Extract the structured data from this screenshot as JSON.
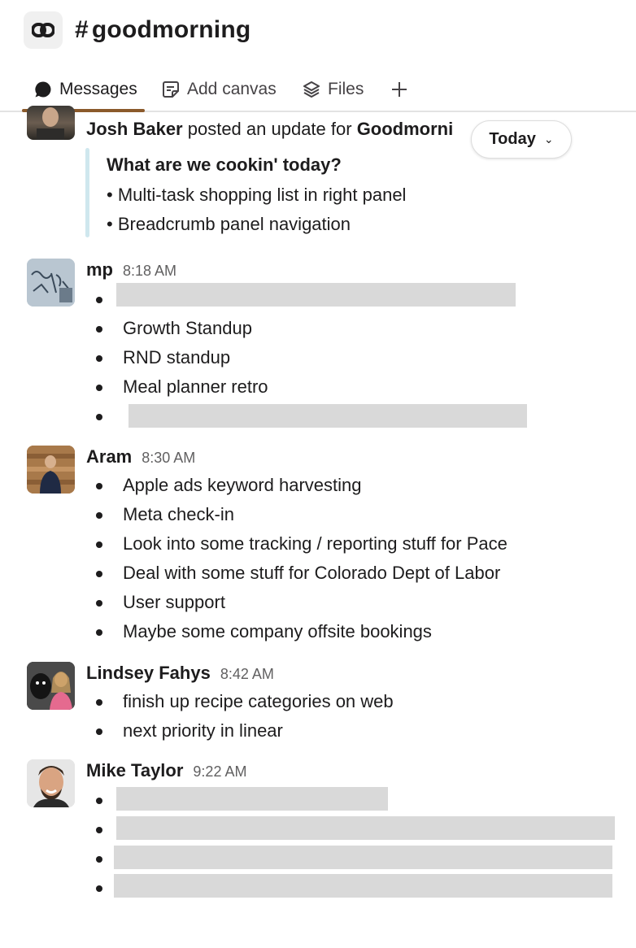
{
  "channel": {
    "hash": "#",
    "name": "goodmorning",
    "icon": "link-icon"
  },
  "tabs": [
    {
      "label": "Messages",
      "icon": "chat-bubble-icon",
      "active": true
    },
    {
      "label": "Add canvas",
      "icon": "canvas-icon",
      "active": false
    },
    {
      "label": "Files",
      "icon": "layers-icon",
      "active": false
    },
    {
      "label": "+",
      "icon": "plus-icon",
      "active": false
    }
  ],
  "date_divider": {
    "label": "Today",
    "icon": "chevron-down-icon"
  },
  "post": {
    "author": "Josh Baker",
    "text_middle": " posted an update for ",
    "target": "Goodmorni",
    "title": "What are we cookin' today?",
    "items": [
      "Multi-task shopping list in right panel",
      "Breadcrumb panel navigation"
    ]
  },
  "messages": [
    {
      "author": "mp",
      "time": "8:18 AM",
      "items": [
        "",
        "Growth Standup",
        "RND standup",
        "Meal planner retro",
        ""
      ]
    },
    {
      "author": "Aram",
      "time": "8:30 AM",
      "items": [
        "Apple ads keyword harvesting",
        "Meta check-in",
        "Look into some tracking / reporting stuff for Pace",
        "Deal with some stuff for Colorado Dept of Labor",
        "User support",
        "Maybe some company offsite bookings"
      ]
    },
    {
      "author": "Lindsey Fahys",
      "time": "8:42 AM",
      "items": [
        "finish up recipe categories on web",
        "next priority in linear"
      ]
    },
    {
      "author": "Mike Taylor",
      "time": "9:22 AM",
      "items": [
        "",
        "",
        "",
        ""
      ]
    }
  ],
  "colors": {
    "accent_underline": "#8b5a2b",
    "quote_bar": "#cfe7ee",
    "redaction": "#d9d9d9"
  }
}
